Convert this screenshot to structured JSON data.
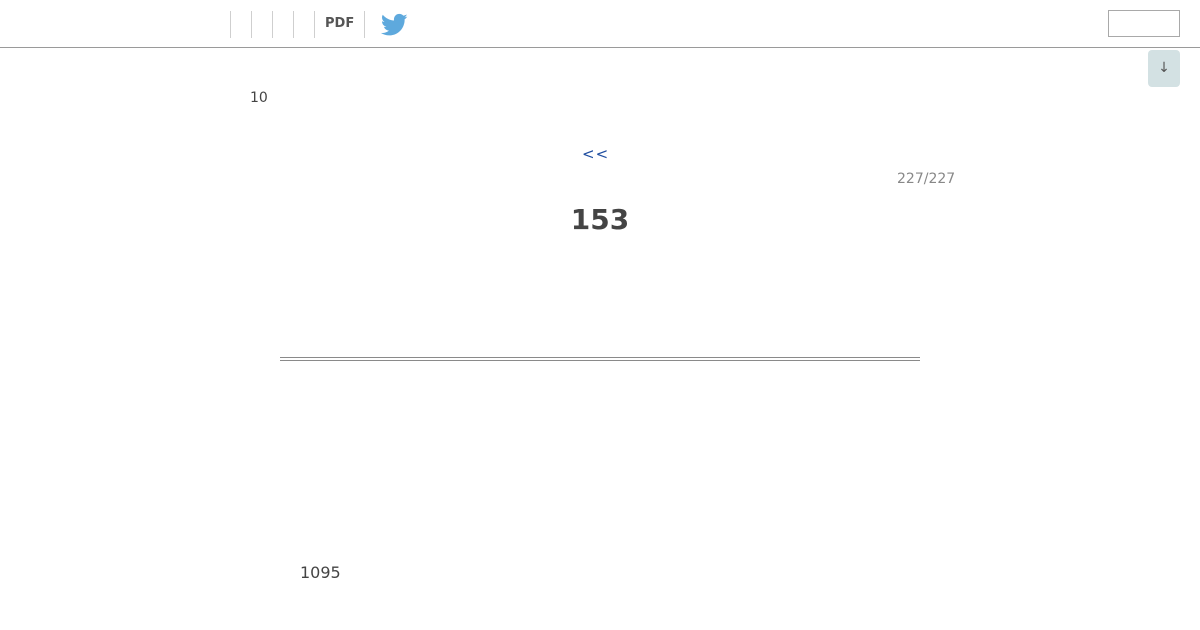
{
  "toolbar": {
    "pdf_label": "PDF",
    "twitter_icon": "twitter-bird-icon",
    "twitter_color": "#5ea9dd",
    "search_value": ""
  },
  "scroll_button": {
    "icon": "arrow-down-icon",
    "label": "↓",
    "background": "#d3e1e3"
  },
  "page": {
    "volume": "10",
    "prev_label": "<<",
    "counter": "227/227",
    "page_number": "153",
    "footer_number": "1095",
    "link_color": "#1f4ea0"
  }
}
